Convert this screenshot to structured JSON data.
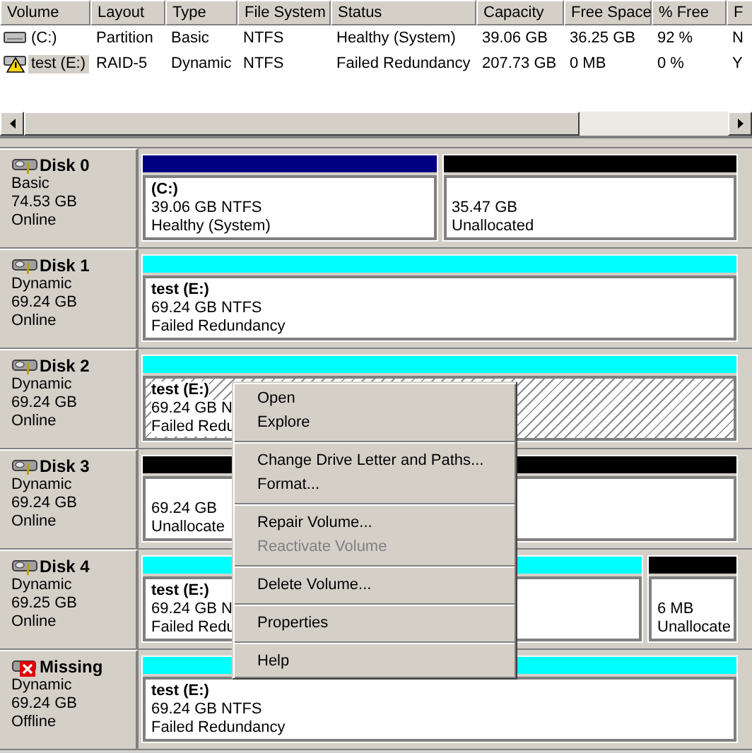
{
  "volume_list": {
    "columns": [
      "Volume",
      "Layout",
      "Type",
      "File System",
      "Status",
      "Capacity",
      "Free Space",
      "% Free",
      "F"
    ],
    "rows": [
      {
        "kind": "drive",
        "selected": false,
        "cells": [
          "(C:)",
          "Partition",
          "Basic",
          "NTFS",
          "Healthy (System)",
          "39.06 GB",
          "36.25 GB",
          "92 %",
          "N"
        ]
      },
      {
        "kind": "warning",
        "selected": true,
        "cells": [
          "test (E:)",
          "RAID-5",
          "Dynamic",
          "NTFS",
          "Failed Redundancy",
          "207.73 GB",
          "0 MB",
          "0 %",
          "Y"
        ]
      }
    ]
  },
  "disks": [
    {
      "kind": "online",
      "name": "Disk 0",
      "type": "Basic",
      "size": "74.53 GB",
      "status": "Online",
      "partitions": [
        {
          "kind": "primary",
          "selected": false,
          "title": "(C:)",
          "lines": [
            "39.06 GB NTFS",
            "Healthy (System)"
          ]
        },
        {
          "kind": "unallocated",
          "selected": false,
          "lines": [
            "35.47 GB",
            "Unallocated"
          ]
        }
      ]
    },
    {
      "kind": "online",
      "name": "Disk 1",
      "type": "Dynamic",
      "size": "69.24 GB",
      "status": "Online",
      "partitions": [
        {
          "kind": "raid5",
          "selected": false,
          "title": "test  (E:)",
          "lines": [
            "69.24 GB NTFS",
            "Failed Redundancy"
          ]
        }
      ]
    },
    {
      "kind": "online",
      "name": "Disk 2",
      "type": "Dynamic",
      "size": "69.24 GB",
      "status": "Online",
      "partitions": [
        {
          "kind": "raid5",
          "selected": true,
          "title": "test  (E:)",
          "lines": [
            "69.24 GB N",
            "Failed Redu"
          ]
        }
      ]
    },
    {
      "kind": "online",
      "name": "Disk 3",
      "type": "Dynamic",
      "size": "69.24 GB",
      "status": "Online",
      "partitions": [
        {
          "kind": "unallocated",
          "selected": false,
          "lines": [
            "69.24 GB",
            "Unallocate"
          ]
        }
      ]
    },
    {
      "kind": "online",
      "name": "Disk 4",
      "type": "Dynamic",
      "size": "69.25 GB",
      "status": "Online",
      "partitions": [
        {
          "kind": "raid5",
          "selected": false,
          "title": "test  (E:)",
          "lines": [
            "69.24 GB N",
            "Failed Redu"
          ]
        },
        {
          "kind": "unallocated",
          "selected": false,
          "lines": [
            "6 MB",
            "Unallocate"
          ]
        }
      ]
    },
    {
      "kind": "missing",
      "name": "Missing",
      "type": "Dynamic",
      "size": "69.24 GB",
      "status": "Offline",
      "partitions": [
        {
          "kind": "raid5",
          "selected": false,
          "title": "test  (E:)",
          "lines": [
            "69.24 GB NTFS",
            "Failed Redundancy"
          ]
        }
      ]
    }
  ],
  "context_menu": [
    {
      "kind": "item",
      "label": "Open",
      "disabled": false
    },
    {
      "kind": "item",
      "label": "Explore",
      "disabled": false
    },
    {
      "kind": "separator"
    },
    {
      "kind": "item",
      "label": "Change Drive Letter and Paths...",
      "disabled": false
    },
    {
      "kind": "item",
      "label": "Format...",
      "disabled": false
    },
    {
      "kind": "separator"
    },
    {
      "kind": "item",
      "label": "Repair Volume...",
      "disabled": false
    },
    {
      "kind": "item",
      "label": "Reactivate Volume",
      "disabled": true
    },
    {
      "kind": "separator"
    },
    {
      "kind": "item",
      "label": "Delete Volume...",
      "disabled": false
    },
    {
      "kind": "separator"
    },
    {
      "kind": "item",
      "label": "Properties",
      "disabled": false
    },
    {
      "kind": "separator"
    },
    {
      "kind": "item",
      "label": "Help",
      "disabled": false
    }
  ]
}
